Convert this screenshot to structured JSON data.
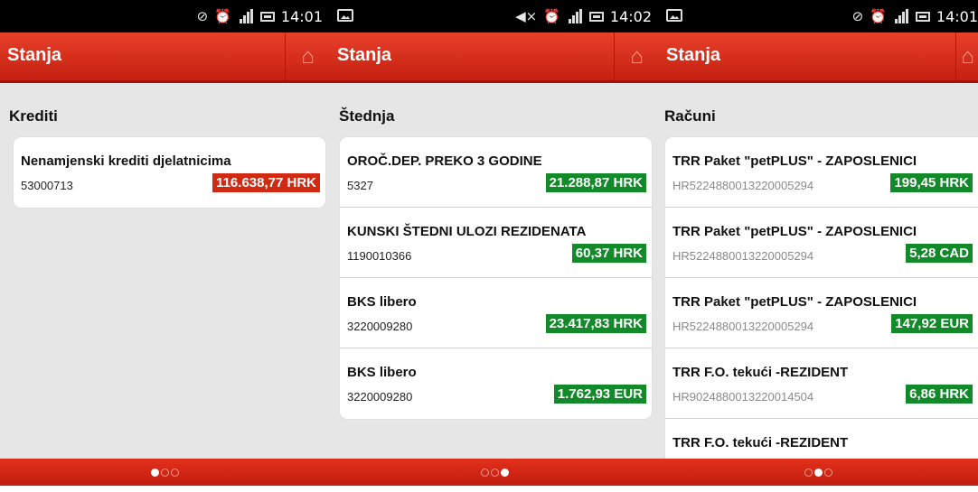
{
  "screens": [
    {
      "status_time": "14:01",
      "title": "Stanja",
      "section": "Krediti",
      "items": [
        {
          "name": "Nenamjenski krediti djelatnicima",
          "account": "53000713",
          "amount": "116.638,77 HRK",
          "color": "#d12a13"
        }
      ],
      "page_indicator": {
        "active": 1,
        "count": 3
      }
    },
    {
      "status_time": "14:02",
      "title": "Stanja",
      "section": "Štednja",
      "items": [
        {
          "name": "OROČ.DEP. PREKO 3 GODINE",
          "account": "5327",
          "amount": "21.288,87 HRK",
          "color": "#138a2a"
        },
        {
          "name": "KUNSKI ŠTEDNI ULOZI REZIDENATA",
          "account": "1190010366",
          "amount": "60,37 HRK",
          "color": "#138a2a"
        },
        {
          "name": "BKS libero",
          "account": "3220009280",
          "amount": "23.417,83 HRK",
          "color": "#138a2a"
        },
        {
          "name": "BKS libero",
          "account": "3220009280",
          "amount": "1.762,93 EUR",
          "color": "#138a2a"
        }
      ],
      "page_indicator": {
        "active": 3,
        "count": 3
      }
    },
    {
      "status_time": "14:01",
      "title": "Stanja",
      "section": "Računi",
      "items": [
        {
          "name": "TRR Paket \"petPLUS\" - ZAPOSLENICI",
          "account": "HR5224880013220005294",
          "amount": "199,45 HRK",
          "color": "#138a2a"
        },
        {
          "name": "TRR Paket \"petPLUS\" - ZAPOSLENICI",
          "account": "HR5224880013220005294",
          "amount": "5,28 CAD",
          "color": "#138a2a"
        },
        {
          "name": "TRR Paket \"petPLUS\" - ZAPOSLENICI",
          "account": "HR5224880013220005294",
          "amount": "147,92 EUR",
          "color": "#138a2a"
        },
        {
          "name": "TRR F.O. tekući -REZIDENT",
          "account": "HR9024880013220014504",
          "amount": "6,86 HRK",
          "color": "#138a2a"
        },
        {
          "name": "TRR F.O. tekući -REZIDENT"
        }
      ],
      "page_indicator": {
        "active": 2,
        "count": 3
      }
    }
  ],
  "icons": {
    "home": "home-icon",
    "alarm": "alarm-clock-icon",
    "signal": "signal-icon",
    "battery": "battery-icon"
  },
  "colors": {
    "header": "#d8301c",
    "positive": "#138a2a",
    "negative": "#d12a13"
  }
}
